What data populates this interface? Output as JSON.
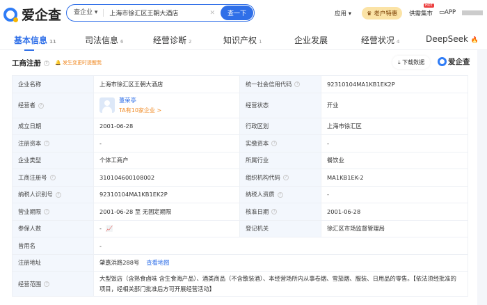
{
  "header": {
    "logo": "爱企查",
    "search_scope": "查企业",
    "search_value": "上海市徐汇区王朝大酒店",
    "search_button": "查一下",
    "nav_apps": "应用",
    "vip": "老户特惠",
    "supply": "供需集市",
    "hot_badge": "HOT",
    "app": "APP"
  },
  "tabs": [
    {
      "label": "基本信息",
      "count": "11"
    },
    {
      "label": "司法信息",
      "count": "6"
    },
    {
      "label": "经营诊断",
      "count": "2"
    },
    {
      "label": "知识产权",
      "count": "1"
    },
    {
      "label": "企业发展",
      "count": ""
    },
    {
      "label": "经营状况",
      "count": "4"
    },
    {
      "label": "DeepSeek",
      "count": ""
    }
  ],
  "section": {
    "title": "工商注册",
    "alert": "发生变更时提醒我",
    "download": "下载数据",
    "brand": "爱企查"
  },
  "info": {
    "name_l": "企业名称",
    "name": "上海市徐汇区王朝大酒店",
    "credit_l": "统一社会信用代码",
    "credit": "92310104MA1KB1EK2P",
    "operator_l": "经营者",
    "operator": "董荣亭",
    "operator_count": "TA有10家企业 >",
    "status_l": "经营状态",
    "status": "开业",
    "date_l": "成立日期",
    "date": "2001-06-28",
    "region_l": "行政区划",
    "region": "上海市徐汇区",
    "capital_l": "注册资本",
    "capital": "-",
    "paid_l": "实缴资本",
    "paid": "-",
    "type_l": "企业类型",
    "type": "个体工商户",
    "industry_l": "所属行业",
    "industry": "餐饮业",
    "regno_l": "工商注册号",
    "regno": "310104600108002",
    "org_l": "组织机构代码",
    "org": "MA1KB1EK-2",
    "taxid_l": "纳税人识别号",
    "taxid": "92310104MA1KB1EK2P",
    "taxq_l": "纳税人资质",
    "taxq": "-",
    "term_l": "营业期限",
    "term": "2001-06-28 至 无固定期限",
    "approve_l": "核准日期",
    "approve": "2001-06-28",
    "insured_l": "参保人数",
    "insured": "-",
    "authority_l": "登记机关",
    "authority": "徐汇区市场监督管理局",
    "former_l": "曾用名",
    "former": "-",
    "addr_l": "注册地址",
    "addr": "肇嘉浜路288号",
    "map": "查看地图",
    "scope_l": "经营范围",
    "scope": "大型饭店（含熟食卤味 含生食海产品）、酒类商品（不含散装酒）、本经营场所内从事卷烟、雪茄烟、服装、日用品的零售。【依法须经批准的项目，经相关部门批准后方可开展经营活动】"
  }
}
